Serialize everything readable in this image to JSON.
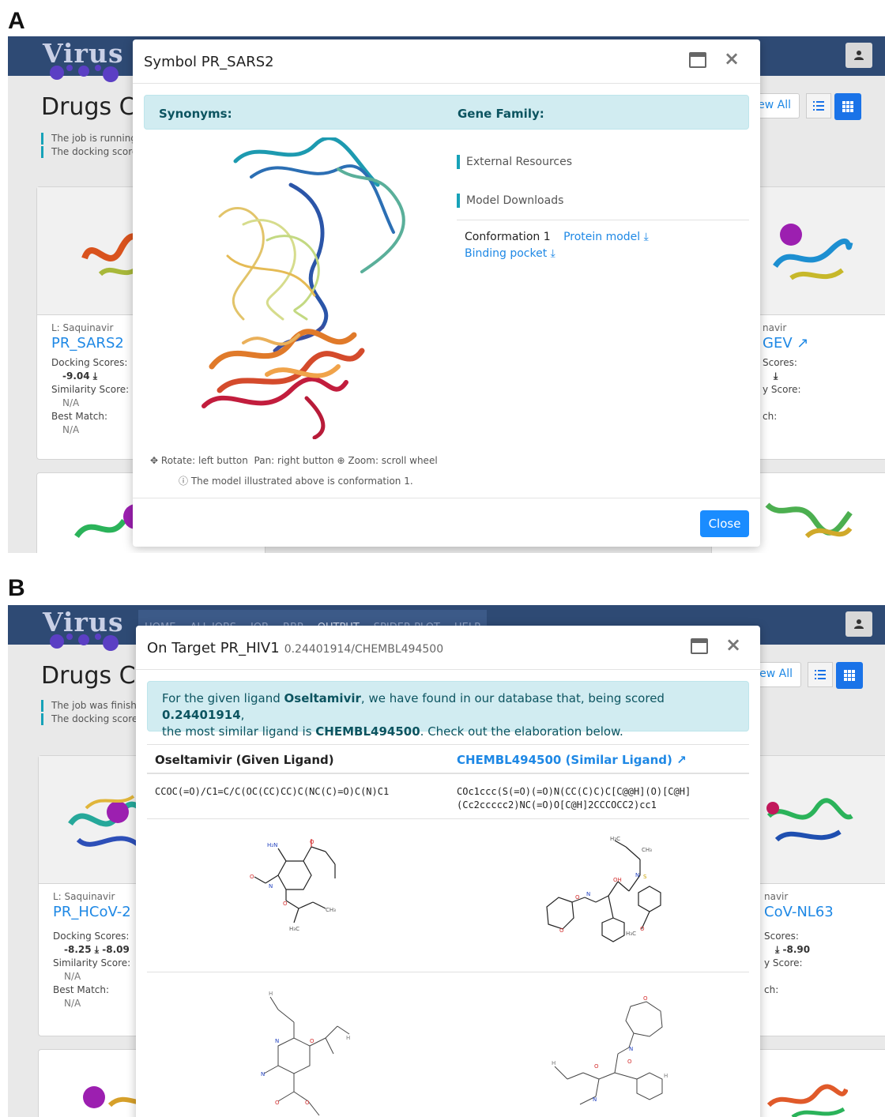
{
  "panels": [
    "A",
    "B"
  ],
  "brand": "Virus",
  "icons": {
    "user": "user-icon",
    "list": "list-icon",
    "grid": "grid-icon",
    "external": "external-link-icon",
    "download": "download-icon",
    "info": "info-circle-icon",
    "move": "move-arrows-icon",
    "zoom": "zoom-in-icon"
  },
  "colors": {
    "navbar": "#2e4a74",
    "accent": "#1a73e8",
    "info_band": "#d1ecf1"
  },
  "panelA": {
    "page_title": "Drugs C",
    "status": [
      "The job is running",
      "The docking score"
    ],
    "view_all": "ew All",
    "card_left": {
      "ligand": "L: Saquinavir",
      "target": "PR_SARS2",
      "docking_label": "Docking Scores:",
      "docking_value": "-9.04",
      "similarity_label": "Similarity Score:",
      "similarity_value": "N/A",
      "best_label": "Best Match:",
      "best_value": "N/A"
    },
    "card_right": {
      "ligand": "navir",
      "target": "GEV",
      "docking_label": "Scores:",
      "similarity_label": "y Score:",
      "best_label": "ch:"
    },
    "modal": {
      "title": "Symbol PR_SARS2",
      "synonyms_label": "Synonyms:",
      "gene_family_label": "Gene Family:",
      "external_resources": "External Resources",
      "model_downloads": "Model Downloads",
      "conformation": "Conformation 1",
      "protein_model": "Protein model",
      "binding_pocket": "Binding pocket",
      "hint_rotate": "Rotate: left button",
      "hint_pan": "Pan: right button",
      "hint_zoom": "Zoom: scroll wheel",
      "model_note": "The model illustrated above is conformation 1.",
      "close": "Close"
    }
  },
  "panelB": {
    "nav": [
      "HOME",
      "ALL JOBS",
      "JOB",
      "RBP",
      "OUTPUT",
      "SPIDER PLOT",
      "HELP"
    ],
    "page_title": "Drugs C",
    "status": [
      "The job was finish",
      "The docking score"
    ],
    "view_all": "ew All",
    "card_left": {
      "ligand": "L: Saquinavir",
      "target": "PR_HCoV-2",
      "docking_label": "Docking Scores:",
      "docking_value": "-8.25",
      "docking_value2": "-8.09",
      "similarity_label": "Similarity Score:",
      "similarity_value": "N/A",
      "best_label": "Best Match:",
      "best_value": "N/A"
    },
    "card_right": {
      "ligand": "navir",
      "target": "CoV-NL63",
      "docking_label": "Scores:",
      "docking_value": "-8.90",
      "similarity_label": "y Score:",
      "best_label": "ch:"
    },
    "modal": {
      "title": "On Target PR_HIV1",
      "title_sub": "0.24401914/CHEMBL494500",
      "sentence_pre": "For the given ligand ",
      "ligand": "Oseltamivir",
      "sentence_mid": ", we have found in our database that, being scored ",
      "score": "0.24401914",
      "sentence_mid2": ",",
      "sentence_line2_pre": "the most similar ligand is ",
      "similar": "CHEMBL494500",
      "sentence_end": ". Check out the elaboration below.",
      "col_given": "Oseltamivir (Given Ligand)",
      "col_similar": "CHEMBL494500 (Similar Ligand)",
      "smiles_given": "CCOC(=O)/C1=C/C(OC(CC)CC)C(NC(C)=O)C(N)C1",
      "smiles_similar_1": "COc1ccc(S(=O)(=O)N(CC(C)C)C[C@@H](O)[C@H]",
      "smiles_similar_2": "(Cc2ccccc2)NC(=O)O[C@H]2CCCOCC2)cc1"
    }
  }
}
